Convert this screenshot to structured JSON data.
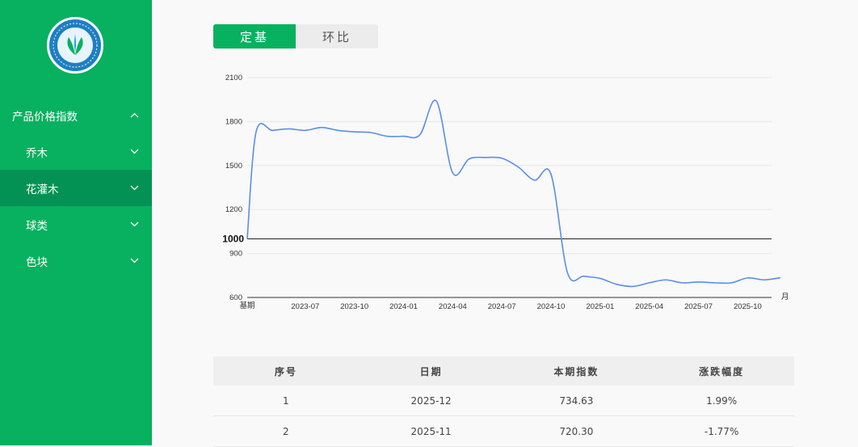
{
  "sidebar": {
    "items": [
      {
        "label": "产品价格指数",
        "level": "top",
        "chevron": "chevron-up-icon"
      },
      {
        "label": "乔木",
        "level": "sub",
        "chevron": "chevron-down-icon"
      },
      {
        "label": "花灌木",
        "level": "sub",
        "chevron": "chevron-down-icon",
        "active": true
      },
      {
        "label": "球类",
        "level": "sub",
        "chevron": "chevron-down-icon"
      },
      {
        "label": "色块",
        "level": "sub",
        "chevron": "chevron-down-icon"
      }
    ]
  },
  "tabs": [
    {
      "label": "定基",
      "active": true
    },
    {
      "label": "环比",
      "active": false
    }
  ],
  "colors": {
    "brand": "#07b15f",
    "brand_dark": "#049254",
    "line": "#5b8ee6"
  },
  "chart_data": {
    "type": "line",
    "ylim": [
      600,
      2100
    ],
    "yticks": [
      "600",
      "900",
      "1200",
      "1500",
      "1800",
      "2100"
    ],
    "baseline_value": 1000,
    "baseline_label": "1000",
    "x_start_label": "基期",
    "x_unit_label": "月",
    "xticks": [
      "2023-07",
      "2023-10",
      "2024-01",
      "2024-04",
      "2024-07",
      "2024-10",
      "2025-01",
      "2025-04",
      "2025-07",
      "2025-10"
    ],
    "series": [
      {
        "x": [
          "基期",
          "2023-04",
          "2023-05",
          "2023-06",
          "2023-07",
          "2023-08",
          "2023-09",
          "2023-10",
          "2023-11",
          "2023-12",
          "2024-01",
          "2024-02",
          "2024-03",
          "2024-04",
          "2024-05",
          "2024-06",
          "2024-07",
          "2024-08",
          "2024-09",
          "2024-10",
          "2024-11",
          "2024-12",
          "2025-01",
          "2025-02",
          "2025-03",
          "2025-04",
          "2025-05",
          "2025-06",
          "2025-07",
          "2025-08",
          "2025-09",
          "2025-10",
          "2025-11",
          "2025-12"
        ],
        "values": [
          1000,
          1730,
          1740,
          1750,
          1740,
          1760,
          1740,
          1730,
          1725,
          1700,
          1700,
          1710,
          1940,
          1450,
          1545,
          1555,
          1550,
          1490,
          1400,
          1440,
          770,
          745,
          730,
          690,
          675,
          700,
          720,
          700,
          705,
          700,
          700,
          733,
          720,
          735
        ]
      }
    ]
  },
  "table": {
    "headers": [
      "序号",
      "日期",
      "本期指数",
      "涨跌幅度"
    ],
    "rows": [
      [
        "1",
        "2025-12",
        "734.63",
        "1.99%"
      ],
      [
        "2",
        "2025-11",
        "720.30",
        "-1.77%"
      ]
    ]
  }
}
